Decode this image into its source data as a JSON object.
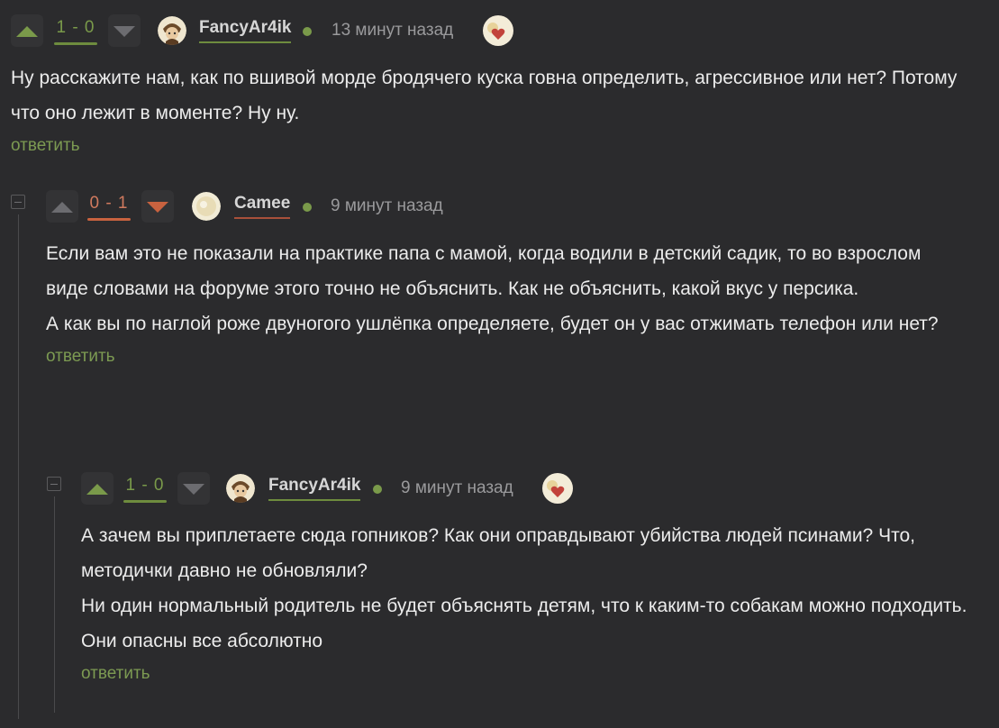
{
  "comments": [
    {
      "rating": "1 - 0",
      "username": "FancyAr4ik",
      "time": "13 минут назад",
      "text": "Ну расскажите нам, как по вшивой морде бродячего куска говна определить, агрессивное или нет? Потому что оно лежит в моменте? Ну ну.",
      "reply": "ответить"
    },
    {
      "rating": "0 - 1",
      "username": "Camee",
      "time": "9 минут назад",
      "text_lines": [
        "Если вам это не показали на практике папа с мамой, когда водили в детский садик, то во взрослом виде словами на форуме этого точно не объяснить. Как не объяснить, какой вкус у персика.",
        "А как вы по наглой роже двуногого ушлёпка определяете, будет он у вас отжимать телефон или нет?"
      ],
      "reply": "ответить"
    },
    {
      "rating": "1 - 0",
      "username": "FancyAr4ik",
      "time": "9 минут назад",
      "text_lines": [
        "А зачем вы приплетаете сюда гопников? Как они оправдывают убийства людей псинами? Что, методички давно не обновляли?",
        "Ни один нормальный родитель не будет объяснять детям, что к каким-то собакам можно подходить. Они опасны все абсолютно"
      ],
      "reply": "ответить"
    }
  ],
  "icons": {
    "upvote": "arrow-up-icon",
    "downvote": "arrow-down-icon",
    "collapse": "collapse-icon",
    "award": "heart-award-icon"
  },
  "colors": {
    "background": "#2b2b2d",
    "positive": "#7a9a4a",
    "negative": "#c8623f",
    "reply": "#7c9a52"
  }
}
